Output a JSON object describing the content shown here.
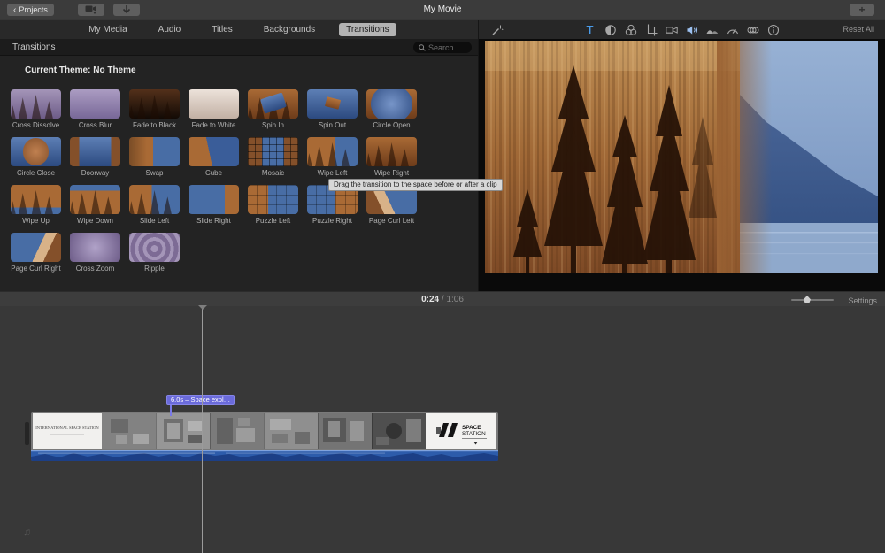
{
  "topbar": {
    "back_chevron": "‹",
    "projects_label": "Projects",
    "title": "My Movie",
    "add_label": "+"
  },
  "tabs": {
    "items": [
      {
        "label": "My Media",
        "selected": false
      },
      {
        "label": "Audio",
        "selected": false
      },
      {
        "label": "Titles",
        "selected": false
      },
      {
        "label": "Backgrounds",
        "selected": false
      },
      {
        "label": "Transitions",
        "selected": true
      }
    ]
  },
  "browser": {
    "panel_title": "Transitions",
    "search_placeholder": "Search",
    "current_theme": "Current Theme: No Theme",
    "tooltip": "Drag the transition to the space before or after a clip",
    "transitions": [
      {
        "label": "Cross Dissolve",
        "thumb": "cross-dissolve"
      },
      {
        "label": "Cross Blur",
        "thumb": "cross-blur"
      },
      {
        "label": "Fade to Black",
        "thumb": "fade-to-black"
      },
      {
        "label": "Fade to White",
        "thumb": "fade-to-white"
      },
      {
        "label": "Spin In",
        "thumb": "spin-in"
      },
      {
        "label": "Spin Out",
        "thumb": "spin-out"
      },
      {
        "label": "Circle Open",
        "thumb": "circle-open"
      },
      {
        "label": "Circle Close",
        "thumb": "circle-close"
      },
      {
        "label": "Doorway",
        "thumb": "doorway"
      },
      {
        "label": "Swap",
        "thumb": "swap"
      },
      {
        "label": "Cube",
        "thumb": "cube"
      },
      {
        "label": "Mosaic",
        "thumb": "mosaic"
      },
      {
        "label": "Wipe Left",
        "thumb": "wipe-left"
      },
      {
        "label": "Wipe Right",
        "thumb": "wipe-right"
      },
      {
        "label": "Wipe Up",
        "thumb": "wipe-up"
      },
      {
        "label": "Wipe Down",
        "thumb": "wipe-down"
      },
      {
        "label": "Slide Left",
        "thumb": "slide-left"
      },
      {
        "label": "Slide Right",
        "thumb": "slide-right"
      },
      {
        "label": "Puzzle Left",
        "thumb": "puzzle-left"
      },
      {
        "label": "Puzzle Right",
        "thumb": "puzzle-right"
      },
      {
        "label": "Page Curl Left",
        "thumb": "page-curl-left"
      },
      {
        "label": "Page Curl Right",
        "thumb": "page-curl-right"
      },
      {
        "label": "Cross Zoom",
        "thumb": "cross-zoom"
      },
      {
        "label": "Ripple",
        "thumb": "ripple"
      }
    ]
  },
  "viewer": {
    "reset_all": "Reset All",
    "titles_glyph": "T",
    "toolbar_icons": [
      "enhance-wand",
      "titles",
      "color-balance",
      "color-correction",
      "crop",
      "stabilization",
      "volume",
      "noise-reduction",
      "speed",
      "clip-filter",
      "clip-info"
    ]
  },
  "timebar": {
    "current": "0:24",
    "separator": "/",
    "total": "1:06",
    "settings_label": "Settings"
  },
  "timeline": {
    "clip_badge": "6.0s – Space expl…",
    "title_card": "INTERNATIONAL SPACE STATION",
    "logo_line1": "SPACE",
    "logo_line2": "STATION"
  },
  "colors": {
    "accent_blue": "#4a9be8",
    "audio_strip_blue": "#2d5cab",
    "badge_purple": "#6b6bdb",
    "selected_tab": "#b3b3b3"
  }
}
